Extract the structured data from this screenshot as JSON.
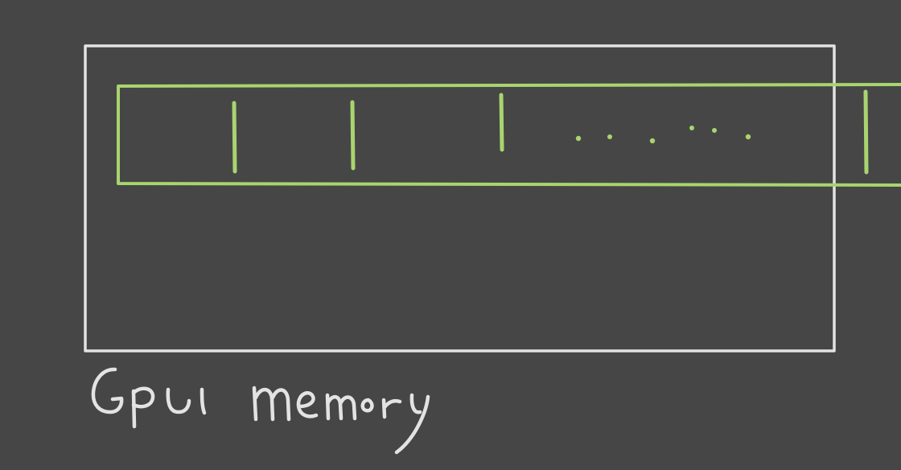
{
  "diagram": {
    "memory_label": "GPU memory",
    "colors": {
      "background": "#464646",
      "memory_outline": "#e3e3e3",
      "strip_outline": "#a9d46f",
      "handwriting": "#e3e3e3"
    },
    "strip": {
      "dividers_before_gap": 3,
      "dividers_after_gap": 1,
      "gap_symbol": ". . . . . . ."
    }
  }
}
